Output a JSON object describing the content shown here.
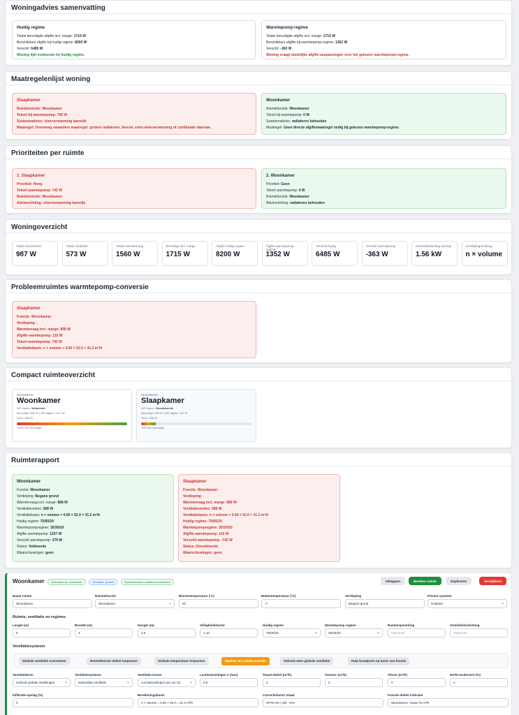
{
  "summary": {
    "title": "Woningadvies samenvatting",
    "current": {
      "title": "Huidig regime",
      "rows": [
        {
          "label": "Totale benodigde afgifte incl. marge:",
          "value": "1715 W"
        },
        {
          "label": "Beschikbare afgifte bij huidig regime:",
          "value": "8200 W"
        },
        {
          "label": "Verschil:",
          "value": "6485 W"
        }
      ],
      "note": "Woning lijkt voldoende bij huidig regime."
    },
    "heatpump": {
      "title": "Warmtepomp-regime",
      "rows": [
        {
          "label": "Totale benodigde afgifte incl. marge:",
          "value": "1715 W"
        },
        {
          "label": "Beschikbare afgifte bij warmtepomp-regime:",
          "value": "1352 W"
        },
        {
          "label": "Verschil:",
          "value": "-363 W"
        }
      ],
      "note": "Woning vraagt duidelijke afgifte-aanpassingen voor het gekozen warmtepomp-regime."
    }
  },
  "measures": {
    "title": "Maatregelenlijst woning",
    "items": [
      {
        "title": "Slaapkamer",
        "rows": [
          {
            "label": "Ruimtefunctie:",
            "value": "Woonkamer"
          },
          {
            "label": "Tekort bij warmtepomp:",
            "value": "742 W"
          },
          {
            "label": "Systeemadvies:",
            "value": "vloerverwarming kansrijk"
          },
          {
            "label": "Maatregel:",
            "value": "Overweeg zwaardere maatregel: grotere radiatoren, fancoil, extra vloerverwarming of combinatie daarvan."
          }
        ]
      },
      {
        "title": "Woonkamer",
        "rows": [
          {
            "label": "Ruimtefunctie:",
            "value": "Woonkamer"
          },
          {
            "label": "Tekort bij warmtepomp:",
            "value": "0 W"
          },
          {
            "label": "Systeemadvies:",
            "value": "radiatoren behouden"
          },
          {
            "label": "Maatregel:",
            "value": "Geen directe afgiftemaatregel nodig bij gekozen warmtepomp-regime."
          }
        ]
      }
    ]
  },
  "priorities": {
    "title": "Prioriteiten per ruimte",
    "items": [
      {
        "title": "1. Slaapkamer",
        "rows": [
          {
            "label": "Prioriteit:",
            "value": "Hoog"
          },
          {
            "label": "Tekort warmtepomp:",
            "value": "742 W"
          },
          {
            "label": "Ruimtefunctie:",
            "value": "Woonkamer"
          },
          {
            "label": "Adviesrichting:",
            "value": "vloerverwarming kansrijk"
          }
        ]
      },
      {
        "title": "2. Woonkamer",
        "rows": [
          {
            "label": "Prioriteit:",
            "value": "Geen"
          },
          {
            "label": "Tekort warmtepomp:",
            "value": "0 W"
          },
          {
            "label": "Ruimtefunctie:",
            "value": "Woonkamer"
          },
          {
            "label": "Adviesrichting:",
            "value": "radiatoren behouden"
          }
        ]
      }
    ]
  },
  "overview": {
    "title": "Woningoverzicht",
    "stats": [
      {
        "label": "Totale transmissie",
        "value": "987 W"
      },
      {
        "label": "Totale ventilatie",
        "value": "573 W"
      },
      {
        "label": "Totale warmtevraag",
        "value": "1560 W"
      },
      {
        "label": "Benodigd incl. marge",
        "value": "1715 W"
      },
      {
        "label": "Afgifte huidig regime",
        "value": "8200 W"
      },
      {
        "label": "Afgifte warmtepomp-regime",
        "value": "1352 W"
      },
      {
        "label": "Verschil huidig",
        "value": "6485 W"
      },
      {
        "label": "Verschil warmtepomp",
        "value": "-363 W"
      },
      {
        "label": "Ontwerpbelasting woning",
        "value": "1.56 kW"
      },
      {
        "label": "Ventilatiegrondslag",
        "value": "n × volume"
      }
    ]
  },
  "problems": {
    "title": "Probleemruimtes warmtepomp-conversie",
    "item": {
      "title": "Slaapkamer",
      "rows": [
        {
          "label": "Functie:",
          "value": "Woonkamer"
        },
        {
          "label": "Verdieping:",
          "value": "-"
        },
        {
          "label": "Warmtevraag incl. marge:",
          "value": "858 W"
        },
        {
          "label": "Afgifte warmtepomp:",
          "value": "115 W"
        },
        {
          "label": "Tekort warmtepomp:",
          "value": "742 W"
        },
        {
          "label": "Ventilatiebasis:",
          "value": "n × volume = 0.60 × 52.0 = 31.2 m³/h"
        }
      ]
    }
  },
  "compact": {
    "title": "Compact ruimteoverzicht",
    "cards": [
      {
        "type": "Woonkamer",
        "name": "Woonkamer",
        "status_label": "WP-status:",
        "status": "Voldoende",
        "line1": "Benodigd: 858 W | WP-afgifte: 1237 W",
        "line2": "Vent.: 288 W",
        "pct": 100,
        "pct_label": "144% van benodigd"
      },
      {
        "type": "Woonkamer",
        "name": "Slaapkamer",
        "status_label": "WP-status:",
        "status": "Onvoldoende",
        "line1": "Benodigd: 858 W | WP-afgifte: 115 W",
        "line2": "Vent.: 288 W",
        "pct": 13,
        "pct_label": "13% van benodigd"
      }
    ]
  },
  "report": {
    "title": "Ruimterapport",
    "items": [
      {
        "title": "Woonkamer",
        "rows": [
          {
            "label": "Functie:",
            "value": "Woonkamer"
          },
          {
            "label": "Verdieping:",
            "value": "Begane grond"
          },
          {
            "label": "Warmtevraag incl. marge:",
            "value": "858 W"
          },
          {
            "label": "Ventilatieverlies:",
            "value": "288 W"
          },
          {
            "label": "Ventilatiebasis:",
            "value": "n × volume = 0.60 × 52.0 = 31.2 m³/h"
          },
          {
            "label": "Huidig regime:",
            "value": "75/65/20"
          },
          {
            "label": "Warmtepompregime:",
            "value": "35/30/20"
          },
          {
            "label": "Afgifte warmtepomp:",
            "value": "1237 W"
          },
          {
            "label": "Verschil warmtepomp:",
            "value": "379 W"
          },
          {
            "label": "Status:",
            "value": "Voldoende"
          },
          {
            "label": "Waarschuwingen:",
            "value": "geen"
          }
        ]
      },
      {
        "title": "Slaapkamer",
        "rows": [
          {
            "label": "Functie:",
            "value": "Woonkamer"
          },
          {
            "label": "Verdieping:",
            "value": "-"
          },
          {
            "label": "Warmtevraag incl. marge:",
            "value": "858 W"
          },
          {
            "label": "Ventilatieverlies:",
            "value": "288 W"
          },
          {
            "label": "Ventilatiebasis:",
            "value": "n × volume = 0.60 × 52.0 = 31.2 m³/h"
          },
          {
            "label": "Huidig regime:",
            "value": "75/65/20"
          },
          {
            "label": "Warmtepompregime:",
            "value": "35/30/20"
          },
          {
            "label": "Afgifte warmtepomp:",
            "value": "115 W"
          },
          {
            "label": "Verschil warmtepomp:",
            "value": "-742 W"
          },
          {
            "label": "Status:",
            "value": "Onvoldoende"
          },
          {
            "label": "Waarschuwingen:",
            "value": "geen"
          }
        ]
      }
    ]
  },
  "editor": {
    "room_title": "Woonkamer",
    "tags": [
      "Warmtepomp: voldoende",
      "Ventilatie: globaal",
      "Systeemadvies: radiatoren behouden"
    ],
    "buttons": {
      "collapse": "Inklappen",
      "calc": "Bereken ruimte",
      "duplicate": "Dupliceren",
      "delete": "Verwijderen"
    },
    "row1": [
      {
        "label": "Naam ruimte",
        "value": "Woonkamer",
        "select": false
      },
      {
        "label": "Ruimtefunctie",
        "value": "Woonkamer",
        "select": true
      },
      {
        "label": "Binnentemperatuur (°C)",
        "value": "20",
        "select": false
      },
      {
        "label": "Buitentemperatuur (°C)",
        "value": "-7",
        "select": false
      },
      {
        "label": "Verdieping",
        "value": "Begane grond",
        "select": false
      },
      {
        "label": "Primair systeem",
        "value": "Radiator",
        "select": true
      }
    ],
    "section2": "Ruimte, ventilatie en regimes",
    "row2": [
      {
        "label": "Lengte (m)",
        "value": "5",
        "select": false,
        "ph": false
      },
      {
        "label": "Breedte (m)",
        "value": "4",
        "select": false,
        "ph": false
      },
      {
        "label": "Hoogte (m)",
        "value": "2.6",
        "select": false,
        "ph": false
      },
      {
        "label": "Veiligheidsfactor",
        "value": "1.10",
        "select": false,
        "ph": false
      },
      {
        "label": "Huidig regime",
        "value": "75/65/20",
        "select": true,
        "ph": false
      },
      {
        "label": "Warmtepomp regime",
        "value": "35/30/20",
        "select": true,
        "ph": false
      },
      {
        "label": "Ruimteopmerking",
        "value": "Optioneel",
        "select": false,
        "ph": true
      },
      {
        "label": "Ventilatietoelichting",
        "value": "Optioneel",
        "select": false,
        "ph": true
      }
    ],
    "section3": "Ventilatiesysteem",
    "toolbar": [
      "Globale ventilatie overnemen",
      "Ruimtefunctie debiet toepassen",
      "Globale temperatuur toepassen",
      "Markeer als ruimte-override",
      "Gebruik weer globale ventilatie",
      "Hulp bouwjaren op basis van functie"
    ],
    "row3": [
      {
        "label": "Ventilatiebron",
        "value": "Gebruik globale instellingen",
        "select": true
      },
      {
        "label": "Ventilatiesysteem",
        "value": "Natuurlijke ventilatie",
        "select": true
      },
      {
        "label": "Ventilatie-invoer",
        "value": "Luchtwisselingen per uur (n)",
        "select": true
      },
      {
        "label": "Luchtwisselingen n (/uur)",
        "value": "0.6",
        "select": false
      },
      {
        "label": "Totaal debiet (m³/h)",
        "value": "0",
        "select": false
      },
      {
        "label": "Toevoer (m³/h)",
        "value": "0",
        "select": false
      },
      {
        "label": "Afvoer (m³/h)",
        "value": "0",
        "select": false
      },
      {
        "label": "WTW-rendement (%)",
        "value": "0",
        "select": false
      }
    ],
    "row4": [
      {
        "label": "Infiltratie-opslag (%)",
        "value": "0"
      },
      {
        "label": "Berekeningsbasis",
        "value": "n × volume = 0.60 × 52.0 = 31.2 m³/h"
      },
      {
        "label": "Correctiefactor totaal",
        "value": "WTW 0% | infil. +0%"
      },
      {
        "label": "Functie-debiet indicatie",
        "value": "Woonkamer: totaal 75 m³/h"
      }
    ]
  }
}
